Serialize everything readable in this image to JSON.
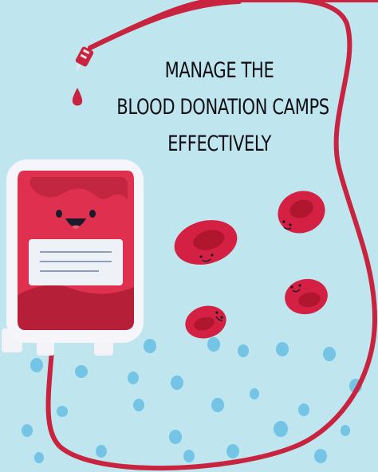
{
  "headline": {
    "line1": "MANAGE THE",
    "line2": "BLOOD DONATION CAMPS",
    "line3": "EFFECTIVELY"
  },
  "colors": {
    "background": "#bfe5ef",
    "blood_red": "#c8233f",
    "bag_red": "#e0304f",
    "bag_dark": "#b51f38",
    "dots": "#74c4e6",
    "text": "#0f0f14"
  },
  "illustration": {
    "bag_icon": "blood-bag-icon",
    "cell_icon": "red-blood-cell-icon",
    "drop_icon": "blood-drop-icon"
  }
}
